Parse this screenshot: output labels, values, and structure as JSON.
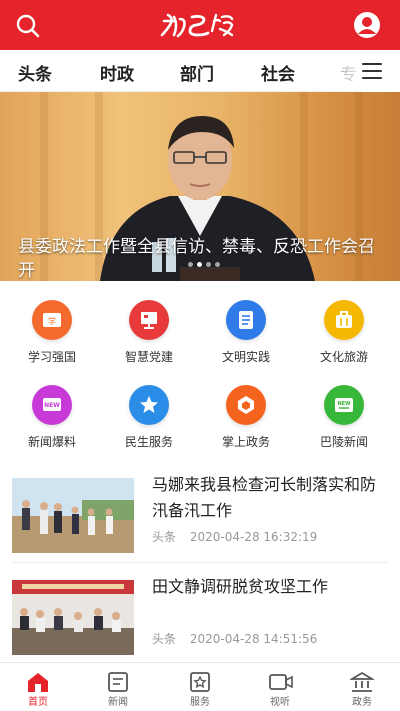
{
  "header": {
    "logo_text": "新巴陵",
    "brand_color": "#e5232a"
  },
  "tabs": [
    {
      "label": "头条"
    },
    {
      "label": "时政"
    },
    {
      "label": "部门"
    },
    {
      "label": "社会"
    },
    {
      "label": "专"
    }
  ],
  "banner": {
    "caption": "县委政法工作暨全县信访、禁毒、反恐工作会召开",
    "slide_count": 4,
    "active_slide": 1
  },
  "services": [
    {
      "label": "学习强国",
      "icon": "study-icon",
      "color": "#f15a24"
    },
    {
      "label": "智慧党建",
      "icon": "party-building-icon",
      "color": "#e83a3a"
    },
    {
      "label": "文明实践",
      "icon": "document-icon",
      "color": "#2f7be8"
    },
    {
      "label": "文化旅游",
      "icon": "luggage-icon",
      "color": "#f5b800"
    },
    {
      "label": "新闻爆料",
      "icon": "new-message-icon",
      "color": "#c83ad8"
    },
    {
      "label": "民生服务",
      "icon": "star-icon",
      "color": "#2a8de8"
    },
    {
      "label": "掌上政务",
      "icon": "government-icon",
      "color": "#f5641e"
    },
    {
      "label": "巴陵新闻",
      "icon": "news-icon",
      "color": "#38b83a"
    }
  ],
  "news": [
    {
      "title": "马娜来我县检查河长制落实和防汛备汛工作",
      "source": "头条",
      "time": "2020-04-28 16:32:19"
    },
    {
      "title": "田文静调研脱贫攻坚工作",
      "source": "头条",
      "time": "2020-04-28 14:51:56"
    }
  ],
  "bottom_nav": [
    {
      "label": "首页",
      "icon": "home-icon",
      "active": true
    },
    {
      "label": "新闻",
      "icon": "news-icon",
      "active": false
    },
    {
      "label": "服务",
      "icon": "service-icon",
      "active": false
    },
    {
      "label": "视听",
      "icon": "video-icon",
      "active": false
    },
    {
      "label": "政务",
      "icon": "government-icon",
      "active": false
    }
  ]
}
